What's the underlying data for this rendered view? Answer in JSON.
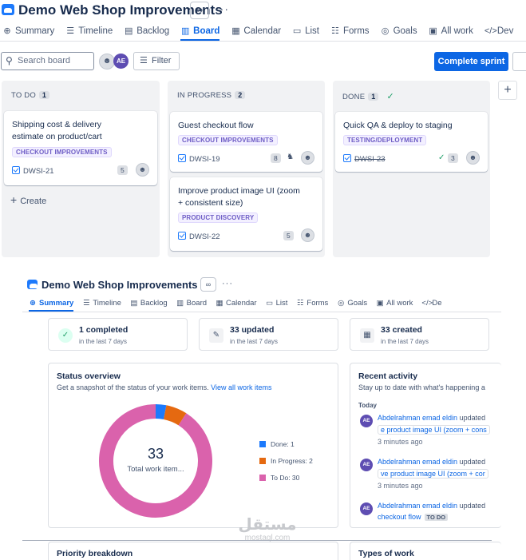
{
  "board": {
    "project_title": "Demo Web Shop Improvements",
    "tabs": [
      {
        "label": "Summary",
        "icon": "globe-icon",
        "glyph": "⊕"
      },
      {
        "label": "Timeline",
        "icon": "timeline-icon",
        "glyph": "☰"
      },
      {
        "label": "Backlog",
        "icon": "backlog-icon",
        "glyph": "▤"
      },
      {
        "label": "Board",
        "icon": "board-icon",
        "glyph": "▥",
        "active": true
      },
      {
        "label": "Calendar",
        "icon": "calendar-icon",
        "glyph": "▦"
      },
      {
        "label": "List",
        "icon": "list-icon",
        "glyph": "▭"
      },
      {
        "label": "Forms",
        "icon": "forms-icon",
        "glyph": "☷"
      },
      {
        "label": "Goals",
        "icon": "goals-icon",
        "glyph": "◎"
      },
      {
        "label": "All work",
        "icon": "all-work-icon",
        "glyph": "▣"
      },
      {
        "label": "Dev",
        "icon": "code-icon",
        "glyph": "</>"
      }
    ],
    "search_placeholder": "Search board",
    "avatar_initials": "AE",
    "filter_label": "Filter",
    "complete_sprint_label": "Complete sprint",
    "columns": [
      {
        "name": "TO DO",
        "count": "1",
        "create_label": "Create",
        "cards": [
          {
            "title": "Shipping cost & delivery estimate on product/cart",
            "label": "CHECKOUT IMPROVEMENTS",
            "key": "DWSI-21",
            "points": "5"
          }
        ]
      },
      {
        "name": "IN PROGRESS",
        "count": "2",
        "cards": [
          {
            "title": "Guest checkout flow",
            "label": "CHECKOUT IMPROVEMENTS",
            "key": "DWSI-19",
            "points": "8"
          },
          {
            "title": "Improve product image UI (zoom + consistent size)",
            "label": "PRODUCT DISCOVERY",
            "key": "DWSI-22",
            "points": "5"
          }
        ]
      },
      {
        "name": "DONE",
        "count": "1",
        "cards": [
          {
            "title": "Quick QA & deploy to staging",
            "label": "TESTING/DEPLOYMENT",
            "key": "DWSI-23",
            "points": "3"
          }
        ]
      }
    ]
  },
  "summary": {
    "project_title": "Demo Web Shop Improvements",
    "tabs": [
      "Summary",
      "Timeline",
      "Backlog",
      "Board",
      "Calendar",
      "List",
      "Forms",
      "Goals",
      "All work",
      "De"
    ],
    "stats": [
      {
        "main": "1 completed",
        "sub": "in the last 7 days",
        "icon": "check-circle-icon"
      },
      {
        "main": "33 updated",
        "sub": "in the last 7 days",
        "icon": "pencil-icon"
      },
      {
        "main": "33 created",
        "sub": "in the last 7 days",
        "icon": "created-icon"
      }
    ],
    "status_overview": {
      "title": "Status overview",
      "subtitle": "Get a snapshot of the status of your work items.",
      "link": "View all work items",
      "total": "33",
      "total_label": "Total work item..."
    },
    "recent_activity": {
      "title": "Recent activity",
      "subtitle": "Stay up to date with what's happening a",
      "group": "Today",
      "items": [
        {
          "who": "Abdelrahman emad eldin",
          "action": "updated",
          "item": "e product image UI (zoom + cons",
          "time": "3 minutes ago"
        },
        {
          "who": "Abdelrahman emad eldin",
          "action": "updated",
          "item": "ve product image UI (zoom + cor",
          "time": "3 minutes ago"
        },
        {
          "who": "Abdelrahman emad eldin",
          "action": "updated",
          "item": "checkout flow",
          "badge": "TO DO"
        }
      ]
    },
    "priority_title": "Priority breakdown",
    "types_title": "Types of work",
    "watermark_ar": "مستقل",
    "watermark_en": "mostaql.com"
  },
  "chart_data": {
    "type": "pie",
    "categories": [
      "Done",
      "In Progress",
      "To Do"
    ],
    "values": [
      1,
      2,
      30
    ],
    "labels": [
      "Done: 1",
      "In Progress: 2",
      "To Do: 30"
    ],
    "colors": [
      "#1d7afc",
      "#e56910",
      "#da62ac"
    ],
    "title": "Status overview",
    "total": 33,
    "legend": "right"
  }
}
